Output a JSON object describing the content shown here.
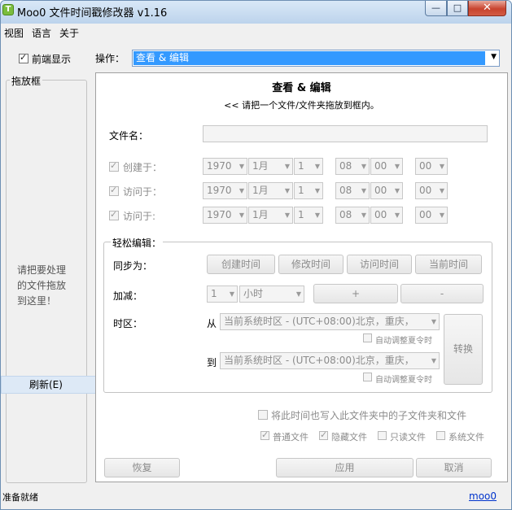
{
  "window": {
    "title": "Moo0 文件时间戳修改器 v1.16",
    "icon_letter": "T"
  },
  "controls": {
    "minimize": "—",
    "maximize": "□",
    "close": "✕"
  },
  "menu": [
    "视图",
    "语言",
    "关于"
  ],
  "always_on_top": {
    "label": "前端显示",
    "checked": true
  },
  "operation": {
    "label": "操作：",
    "value": "查看 & 编辑"
  },
  "drop_zone": {
    "title": "拖放框",
    "text_lines": [
      "请把要处理",
      "的文件拖放",
      "到这里！"
    ],
    "refresh": "刷新(E)"
  },
  "panel": {
    "title": "查看 & 编辑",
    "subtitle": "<< 请把一个文件/文件夹拖放到框内。",
    "filename_label": "文件名：",
    "filename_value": "",
    "rows": [
      {
        "label": "创建于：",
        "year": "1970",
        "month": "1月",
        "day": "1",
        "hour": "08",
        "minute": "00",
        "second": "00"
      },
      {
        "label": "访问于：",
        "year": "1970",
        "month": "1月",
        "day": "1",
        "hour": "08",
        "minute": "00",
        "second": "00"
      },
      {
        "label": "访问于:",
        "year": "1970",
        "month": "1月",
        "day": "1",
        "hour": "08",
        "minute": "00",
        "second": "00"
      }
    ],
    "easy_edit": {
      "title": "轻松编辑：",
      "sync_label": "同步为：",
      "sync_buttons": [
        "创建时间",
        "修改时间",
        "访问时间",
        "当前时间"
      ],
      "add_label": "加减：",
      "add_amount": "1",
      "add_unit": "小时",
      "plus": "+",
      "minus": "-",
      "tz_label": "时区：",
      "from_label": "从",
      "to_label": "到",
      "tz_value": "当前系统时区 - (UTC+08:00)北京，重庆，",
      "auto_dst": "自动调整夏令时",
      "convert": "转换"
    },
    "subfolder_option": "将此时间也写入此文件夹中的子文件夹和文件",
    "file_types": [
      "普通文件",
      "隐藏文件",
      "只读文件",
      "系统文件"
    ],
    "file_types_checked": [
      true,
      true,
      false,
      false
    ],
    "restore": "恢复",
    "apply": "应用",
    "cancel": "取消"
  },
  "status": {
    "text": "准备就绪",
    "link": "moo0"
  }
}
